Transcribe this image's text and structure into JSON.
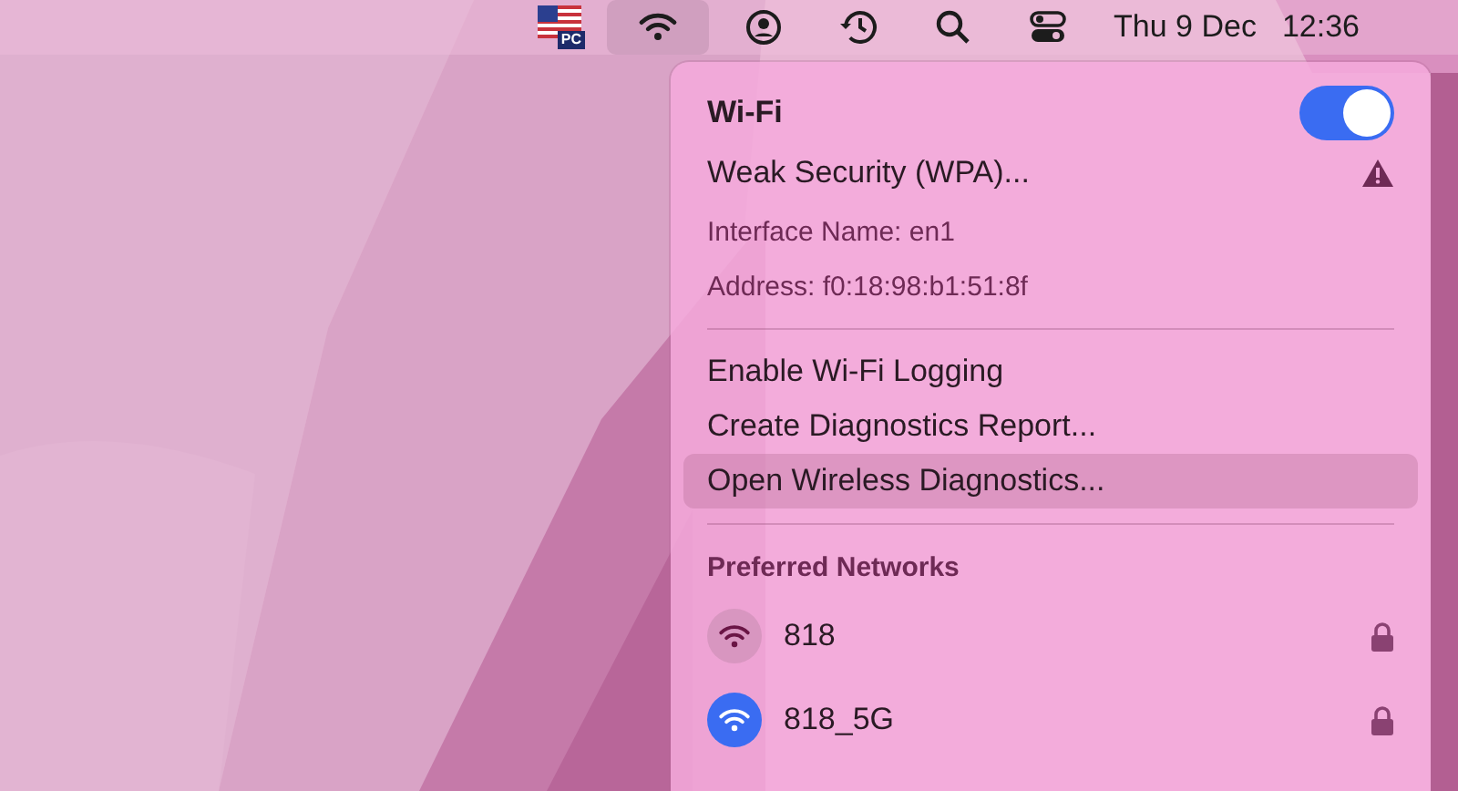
{
  "menu_bar": {
    "input_source_badge": "PC",
    "date": "Thu 9 Dec",
    "time": "12:36"
  },
  "wifi_menu": {
    "title": "Wi-Fi",
    "on": true,
    "info": [
      {
        "kind": "warning",
        "text": "Weak Security (WPA)..."
      },
      {
        "kind": "detail",
        "text": "Interface Name: en1"
      },
      {
        "kind": "detail",
        "text": "Address: f0:18:98:b1:51:8f"
      }
    ],
    "actions": [
      {
        "label": "Enable Wi-Fi Logging",
        "selected": false
      },
      {
        "label": "Create Diagnostics Report...",
        "selected": false
      },
      {
        "label": "Open Wireless Diagnostics...",
        "selected": true
      }
    ],
    "section_title": "Preferred Networks",
    "networks": [
      {
        "name": "818",
        "connected": false,
        "locked": true
      },
      {
        "name": "818_5G",
        "connected": true,
        "locked": true
      }
    ]
  }
}
